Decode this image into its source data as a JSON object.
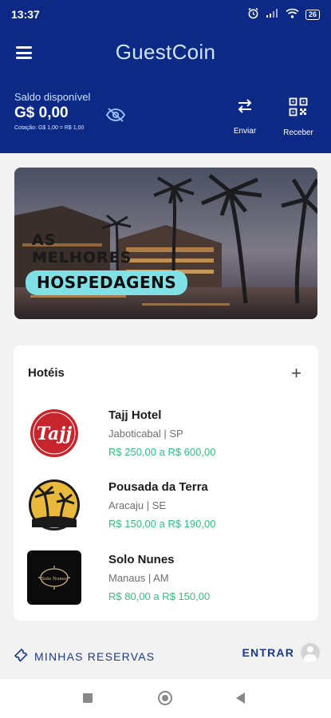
{
  "status_bar": {
    "time": "13:37",
    "battery": "26"
  },
  "header": {
    "brand": "GuestCoin",
    "balance_label": "Saldo disponível",
    "balance_value": "G$ 0,00",
    "exchange_rate": "Cotação: G$ 1,00 = R$ 1,00",
    "actions": {
      "send": "Enviar",
      "receive": "Receber"
    }
  },
  "banner": {
    "line1": "AS",
    "line2": "MELHORES",
    "highlight": "HOSPEDAGENS"
  },
  "hotels_section": {
    "title": "Hotéis",
    "items": [
      {
        "name": "Tajj Hotel",
        "location": "Jaboticabal | SP",
        "price_range": "R$ 250,00 a R$ 600,00",
        "logo_text": "Tajj"
      },
      {
        "name": "Pousada da Terra",
        "location": "Aracaju | SE",
        "price_range": "R$ 150,00 a R$ 190,00"
      },
      {
        "name": "Solo Nunes",
        "location": "Manaus | AM",
        "price_range": "R$ 80,00 a R$ 150,00",
        "logo_text": "Solo Nunes"
      }
    ]
  },
  "bottom": {
    "reservations": "MINHAS RESERVAS",
    "login": "ENTRAR"
  },
  "colors": {
    "primary": "#0c2a85",
    "accent_green": "#2ec27e",
    "banner_chip": "#7fe0e6"
  }
}
